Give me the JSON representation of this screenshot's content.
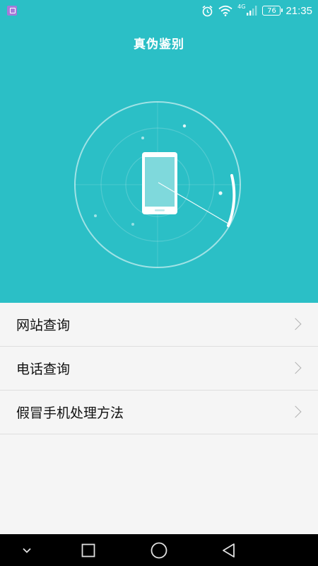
{
  "status_bar": {
    "app_icon": "gallery-icon",
    "alarm_icon": "alarm-clock-icon",
    "wifi_icon": "wifi-icon",
    "network_type": "4G",
    "signal_icon": "signal-icon",
    "battery_level": "76",
    "time": "21:35"
  },
  "header": {
    "title": "真伪鉴别"
  },
  "scanner": {
    "icon": "phone-radar-scan-icon"
  },
  "menu": {
    "items": [
      {
        "label": "网站查询",
        "icon": "chevron-right-icon"
      },
      {
        "label": "电话查询",
        "icon": "chevron-right-icon"
      },
      {
        "label": "假冒手机处理方法",
        "icon": "chevron-right-icon"
      }
    ]
  },
  "nav_bar": {
    "buttons": [
      "chevron-down-icon",
      "recents-square-icon",
      "home-circle-icon",
      "back-triangle-icon"
    ]
  },
  "colors": {
    "hero_background": "#2bbfc6",
    "menu_background": "#f5f5f5",
    "nav_background": "#000000"
  }
}
